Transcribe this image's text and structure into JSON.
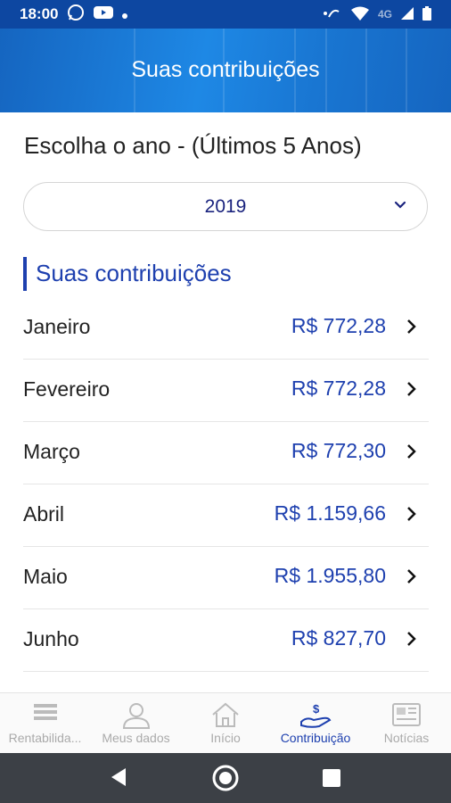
{
  "status_bar": {
    "time": "18:00",
    "network": "4G"
  },
  "header": {
    "title": "Suas contribuições"
  },
  "year_picker": {
    "label": "Escolha o ano - (Últimos 5 Anos)",
    "selected": "2019"
  },
  "section": {
    "title": "Suas contribuições"
  },
  "contributions": [
    {
      "month": "Janeiro",
      "amount": "R$ 772,28"
    },
    {
      "month": "Fevereiro",
      "amount": "R$ 772,28"
    },
    {
      "month": "Março",
      "amount": "R$ 772,30"
    },
    {
      "month": "Abril",
      "amount": "R$ 1.159,66"
    },
    {
      "month": "Maio",
      "amount": "R$ 1.955,80"
    },
    {
      "month": "Junho",
      "amount": "R$ 827,70"
    }
  ],
  "bottom_nav": [
    {
      "label": "Rentabilida...",
      "icon": "list-icon",
      "active": false
    },
    {
      "label": "Meus dados",
      "icon": "user-icon",
      "active": false
    },
    {
      "label": "Início",
      "icon": "home-icon",
      "active": false
    },
    {
      "label": "Contribuição",
      "icon": "hand-money-icon",
      "active": true
    },
    {
      "label": "Notícias",
      "icon": "newspaper-icon",
      "active": false
    }
  ],
  "colors": {
    "primary": "#1e40af",
    "header": "#1976d2",
    "statusbar": "#0d47a1"
  }
}
